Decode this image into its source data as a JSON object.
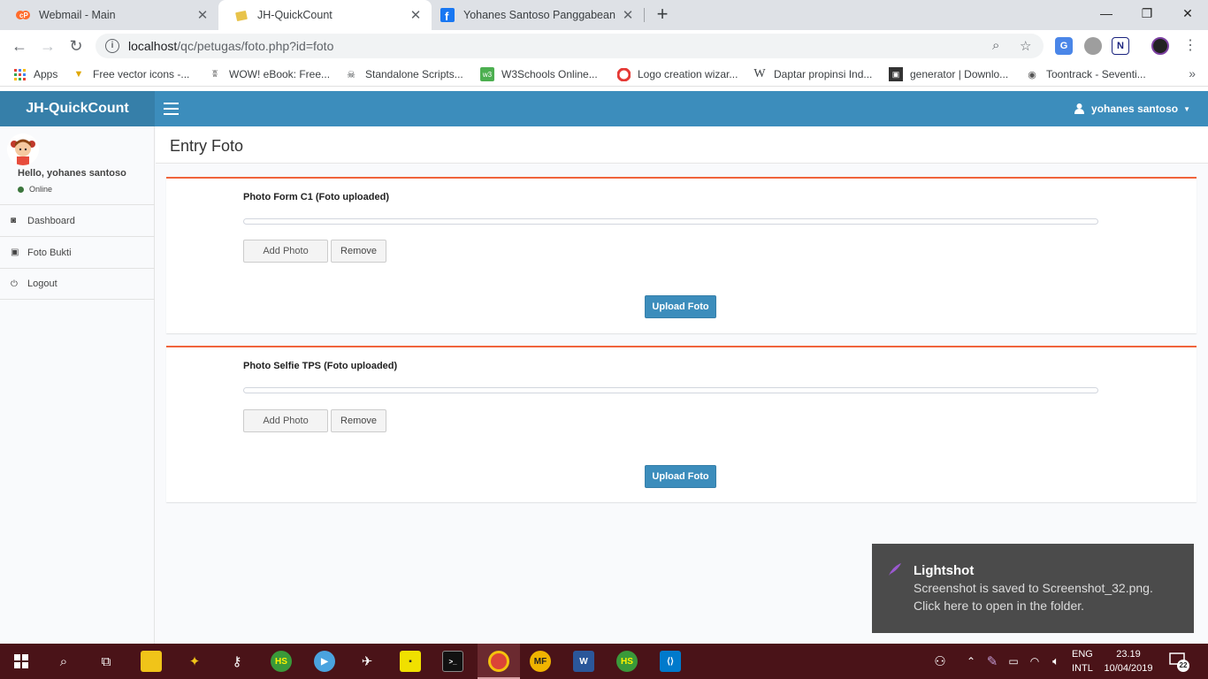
{
  "browser": {
    "tabs": [
      {
        "title": "Webmail - Main",
        "close": "✕"
      },
      {
        "title": "JH-QuickCount",
        "close": "✕"
      },
      {
        "title": "Yohanes Santoso Panggabean",
        "close": "✕"
      }
    ],
    "new_tab": "+",
    "window": {
      "minimize": "—",
      "maximize": "❐",
      "close": "✕"
    },
    "url_host": "localhost",
    "url_path": "/qc/petugas/foto.php?id=foto",
    "bookmarks": [
      {
        "label": "Apps"
      },
      {
        "label": "Free vector icons -..."
      },
      {
        "label": "WOW! eBook: Free..."
      },
      {
        "label": "Standalone Scripts..."
      },
      {
        "label": "W3Schools Online..."
      },
      {
        "label": "Logo creation wizar..."
      },
      {
        "label": "Daptar propinsi Ind..."
      },
      {
        "label": "generator | Downlo..."
      },
      {
        "label": "Toontrack - Seventi..."
      }
    ],
    "bookmarks_more": "»"
  },
  "app": {
    "brand": "JH-QuickCount",
    "user_name": "yohanes santoso",
    "sidebar": {
      "greeting": "Hello, yohanes santoso",
      "status": "Online",
      "items": [
        {
          "label": "Dashboard",
          "icon": "dashboard-icon"
        },
        {
          "label": "Foto Bukti",
          "icon": "camera-icon"
        },
        {
          "label": "Logout",
          "icon": "power-icon"
        }
      ]
    },
    "page_title": "Entry Foto",
    "forms": [
      {
        "title": "Photo Form C1 (Foto uploaded)",
        "progress": 0,
        "add_label": "Add Photo",
        "remove_label": "Remove",
        "upload_label": "Upload Foto"
      },
      {
        "title": "Photo Selfie TPS (Foto uploaded)",
        "progress": 0,
        "add_label": "Add Photo",
        "remove_label": "Remove",
        "upload_label": "Upload Foto"
      }
    ],
    "colors": {
      "header": "#3c8dbc",
      "logo_bg": "#367fa9",
      "box_border": "#f0643c"
    }
  },
  "toast": {
    "title": "Lightshot",
    "line1": "Screenshot is saved to Screenshot_32.png.",
    "line2": "Click here to open in the folder."
  },
  "taskbar": {
    "lang_top": "ENG",
    "lang_bottom": "INTL",
    "time": "23.19",
    "date": "10/04/2019",
    "notification_count": "22"
  }
}
